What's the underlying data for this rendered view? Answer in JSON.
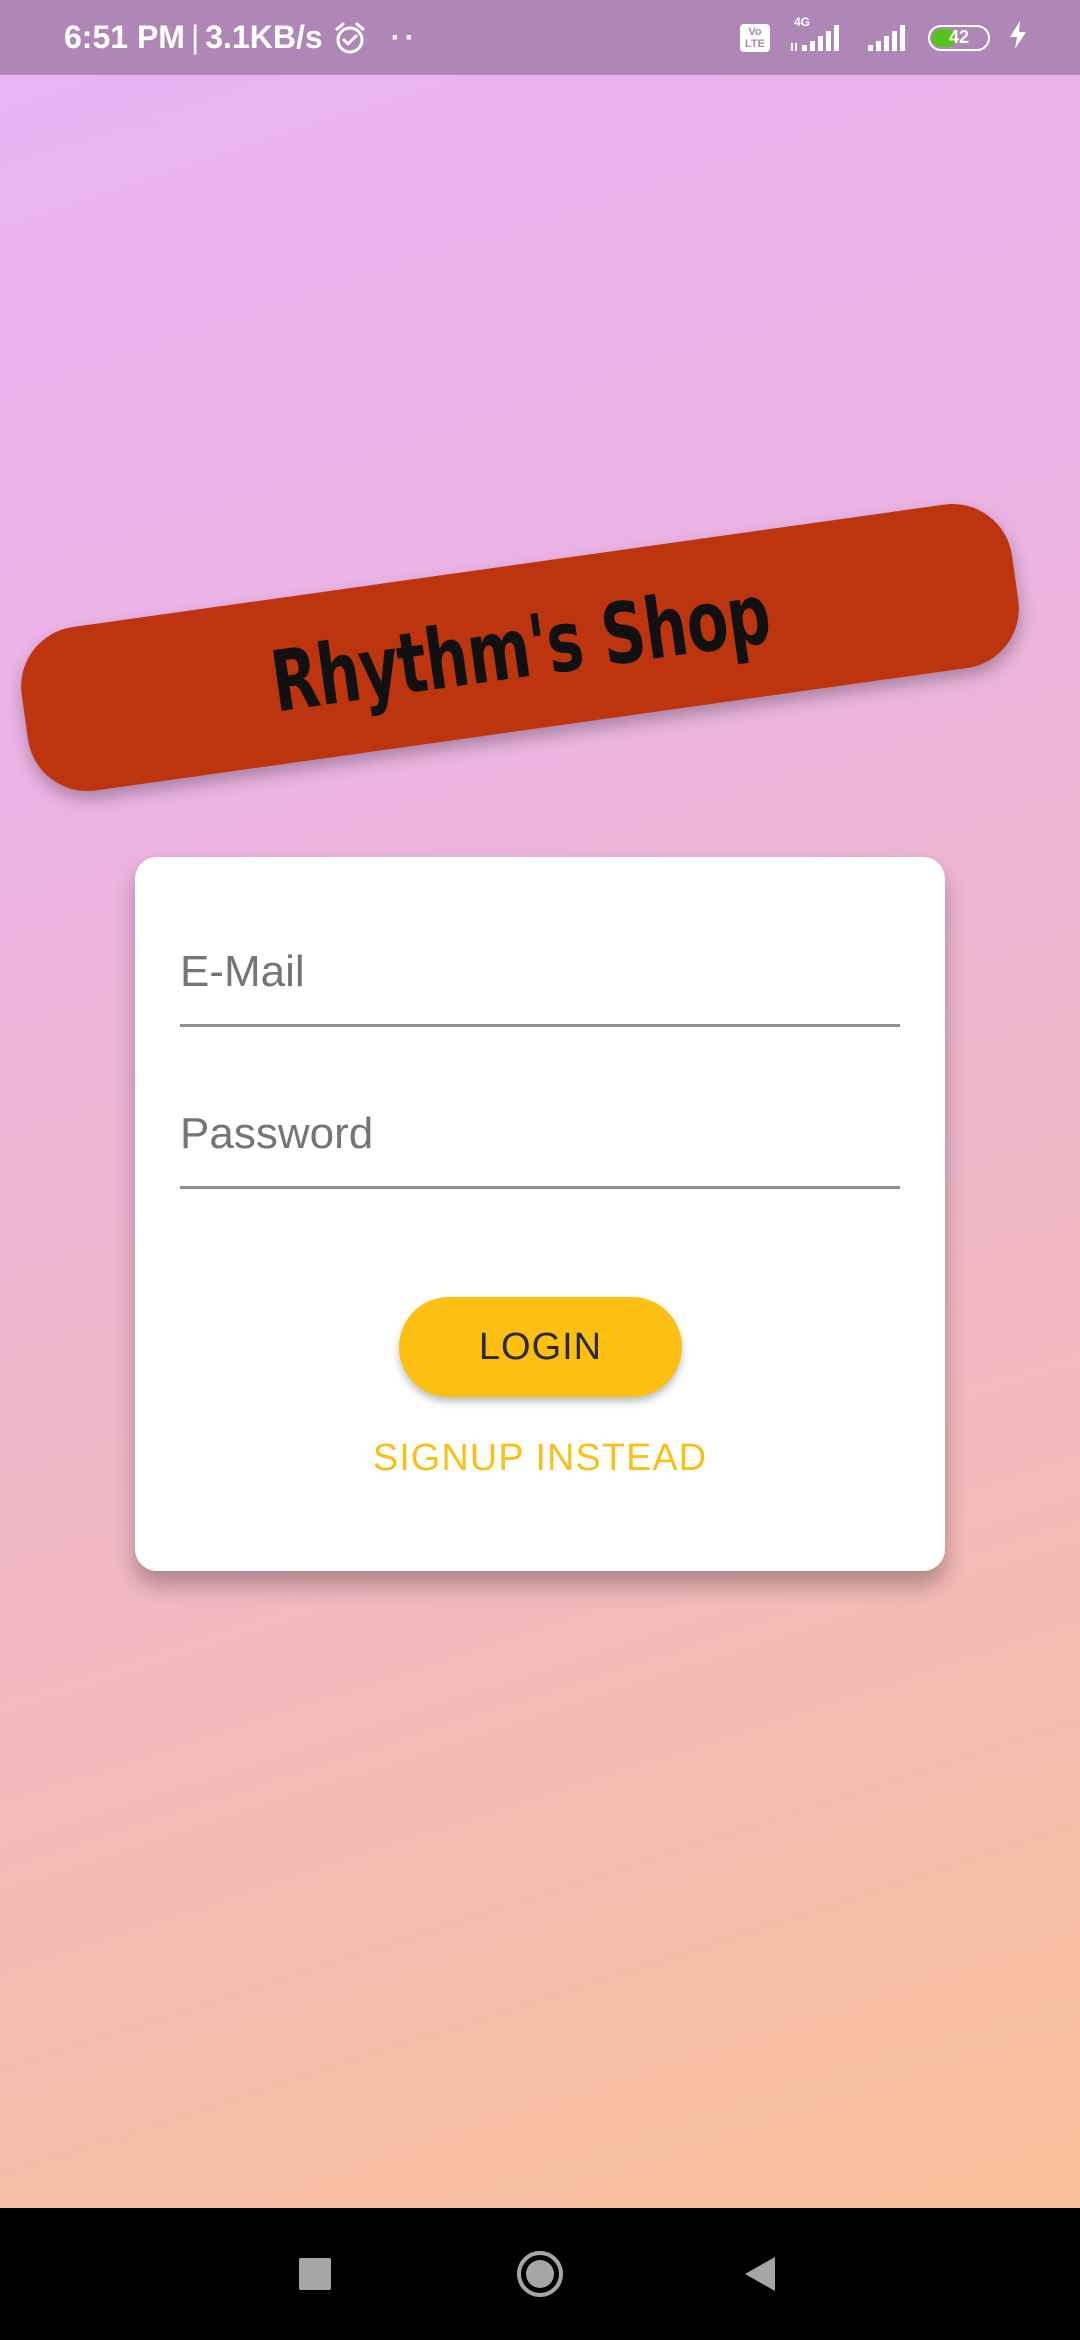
{
  "status_bar": {
    "time": "6:51 PM",
    "separator": "|",
    "speed": "3.1KB/s",
    "dots": "··",
    "volte_top": "Vo",
    "volte_bottom": "LTE",
    "network_type": "4G",
    "battery_level": "42",
    "battery_fill_fraction": 0.42
  },
  "app": {
    "title": "Rhythm's Shop",
    "banner_color": "#bd350e",
    "accent_color": "#fcbf12"
  },
  "login_form": {
    "email_placeholder": "E-Mail",
    "email_value": "",
    "password_placeholder": "Password",
    "password_value": "",
    "login_label": "LOGIN",
    "signup_label": "SIGNUP INSTEAD"
  },
  "nav_bar": {
    "icons": [
      "recents-icon",
      "home-icon",
      "back-icon"
    ]
  }
}
